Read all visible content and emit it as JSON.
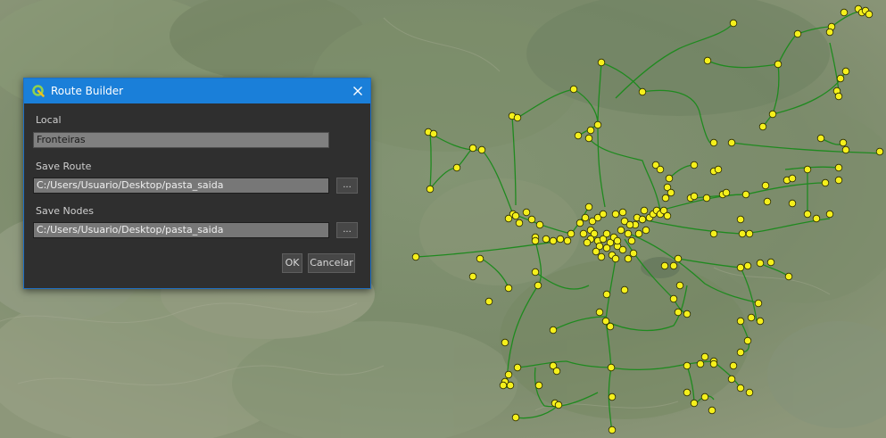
{
  "dialog": {
    "title": "Route Builder",
    "app_icon": "qgis-icon",
    "close_icon": "close-icon",
    "local_label": "Local",
    "local_value": "Fronteiras",
    "save_route_label": "Save Route",
    "save_route_value": "C:/Users/Usuario/Desktop/pasta_saida",
    "save_nodes_label": "Save Nodes",
    "save_nodes_value": "C:/Users/Usuario/Desktop/pasta_saida",
    "browse_label": "...",
    "ok_label": "OK",
    "cancel_label": "Cancelar"
  },
  "map": {
    "route_color": "#1f8a1f",
    "node_fill": "#f5f01c",
    "node_stroke": "#2a2a00"
  }
}
